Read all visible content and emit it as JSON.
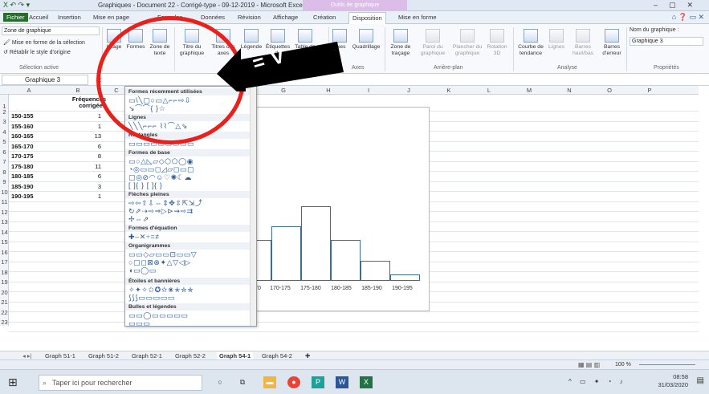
{
  "titlebar": {
    "title": "Graphiques - Document 22 - Corrigé-type - 09-12-2019 - Microsoft Excel",
    "contextual": "Outils de graphique",
    "quick_access": "X ↶ ↷ ▾"
  },
  "tabs": [
    "Fichier",
    "Accueil",
    "Insertion",
    "Mise en page",
    "Formules",
    "Données",
    "Révision",
    "Affichage",
    "Création",
    "Disposition",
    "Mise en forme"
  ],
  "active_tab": "Disposition",
  "ribbon": {
    "selection_value": "Zone de graphique",
    "selection_items": [
      "Mise en forme de la sélection",
      "Rétablir le style d'origine"
    ],
    "group_selection": "Sélection active",
    "insert_buttons": [
      "Image",
      "Formes",
      "Zone de texte"
    ],
    "labels_buttons": [
      "Titre du graphique",
      "Titres des axes",
      "Légende",
      "Étiquettes de données",
      "Table de données"
    ],
    "axes_buttons": [
      "Axes",
      "Quadrillage"
    ],
    "group_axes": "Axes",
    "background_buttons": [
      "Zone de traçage",
      "Paroi du graphique",
      "Plancher du graphique",
      "Rotation 3D"
    ],
    "group_background": "Arrière-plan",
    "analysis_buttons": [
      "Courbe de tendance",
      "Lignes",
      "Barres haut/bas",
      "Barres d'erreur"
    ],
    "group_analysis": "Analyse",
    "chart_name_label": "Nom du graphique :",
    "chart_name_value": "Graphique 3",
    "group_properties": "Propriétés"
  },
  "formula_bar": {
    "name_box": "Graphique 3",
    "fx": "fx"
  },
  "grid": {
    "columns": [
      "A",
      "B",
      "C",
      "D",
      "E",
      "F",
      "G",
      "H",
      "I",
      "J",
      "K",
      "L",
      "M",
      "N",
      "O",
      "P"
    ],
    "rows": [
      "1",
      "2",
      "3",
      "4",
      "5",
      "6",
      "7",
      "8",
      "9",
      "10",
      "11",
      "12",
      "13",
      "14",
      "15",
      "16",
      "17",
      "18",
      "19",
      "20",
      "21",
      "22",
      "23"
    ],
    "header_b": "Fréquences corrigées",
    "data": [
      {
        "a": "150-155",
        "b": "1"
      },
      {
        "a": "155-160",
        "b": "1"
      },
      {
        "a": "160-165",
        "b": "13"
      },
      {
        "a": "165-170",
        "b": "6"
      },
      {
        "a": "170-175",
        "b": "8"
      },
      {
        "a": "175-180",
        "b": "11"
      },
      {
        "a": "180-185",
        "b": "6"
      },
      {
        "a": "185-190",
        "b": "3"
      },
      {
        "a": "190-195",
        "b": "1"
      }
    ]
  },
  "shapes_panel": {
    "sections": [
      "Formes récemment utilisées",
      "Lignes",
      "Rectangles",
      "Formes de base",
      "Flèches pleines",
      "Formes d'équation",
      "Organigrammes",
      "Étoiles et bannières",
      "Bulles et légendes"
    ],
    "rows": [
      "▭\\╲▢○▭△⌐⌐⇨⇩",
      "↘⌒⌒{ }☆",
      "╲╲╲⌐⌐⌐ ⌇⌇⌒△⇘",
      "▭▭▭▭▭▭▭▭▭",
      "▭○△◺▱◇⬡⬠◯◉",
      "◔◎▭▭◻◿▱◻▭▢",
      "▢◎⊘◠☺♡✺☾☁",
      "[ ]{ } [ ]{ }",
      "⇨⇦⇧⇩⇔⇕✥⇳⇱⇲⤴",
      "↻⇗⇢⇨⇒▷⊳⇝⇨⇉",
      "✢⇔⇗",
      "✚–✕÷=≠",
      "▭▭◇▱▭▭⊡▭▭▽",
      "○▢◻⊠⊗✦△▽◁▷",
      "◖▭◯▭",
      "✧✦✧✩✪✫✬✭✮✯",
      "⟆⟆⟆▭▭▭▭▭",
      "▭▭◯▭▭▭▭▭",
      "▭▭▭"
    ]
  },
  "chart_data": {
    "type": "bar",
    "categories": [
      "150-155",
      "155-160",
      "160-165",
      "165-170",
      "170-175",
      "175-180",
      "180-185",
      "185-190",
      "190-195"
    ],
    "values": [
      1,
      1,
      13,
      6,
      8,
      11,
      6,
      3,
      1
    ],
    "visible_tick_labels": [
      "170",
      "170-175",
      "175-180",
      "180-185",
      "185-190",
      "190-195"
    ],
    "bar_color": "#3a6d9a"
  },
  "sheet_tabs": [
    "Graph 51-1",
    "Graph 51-2",
    "Graph 52-1",
    "Graph 52-2",
    "Graph 54-1",
    "Graph 54-2"
  ],
  "active_sheet": "Graph 54-1",
  "status": {
    "zoom": "100 %"
  },
  "taskbar": {
    "search_placeholder": "Taper ici pour rechercher",
    "time": "08:58",
    "date": "31/03/2020"
  },
  "annotation": {
    "arrow_text": "= V",
    "circle_color": "#e8211d"
  }
}
